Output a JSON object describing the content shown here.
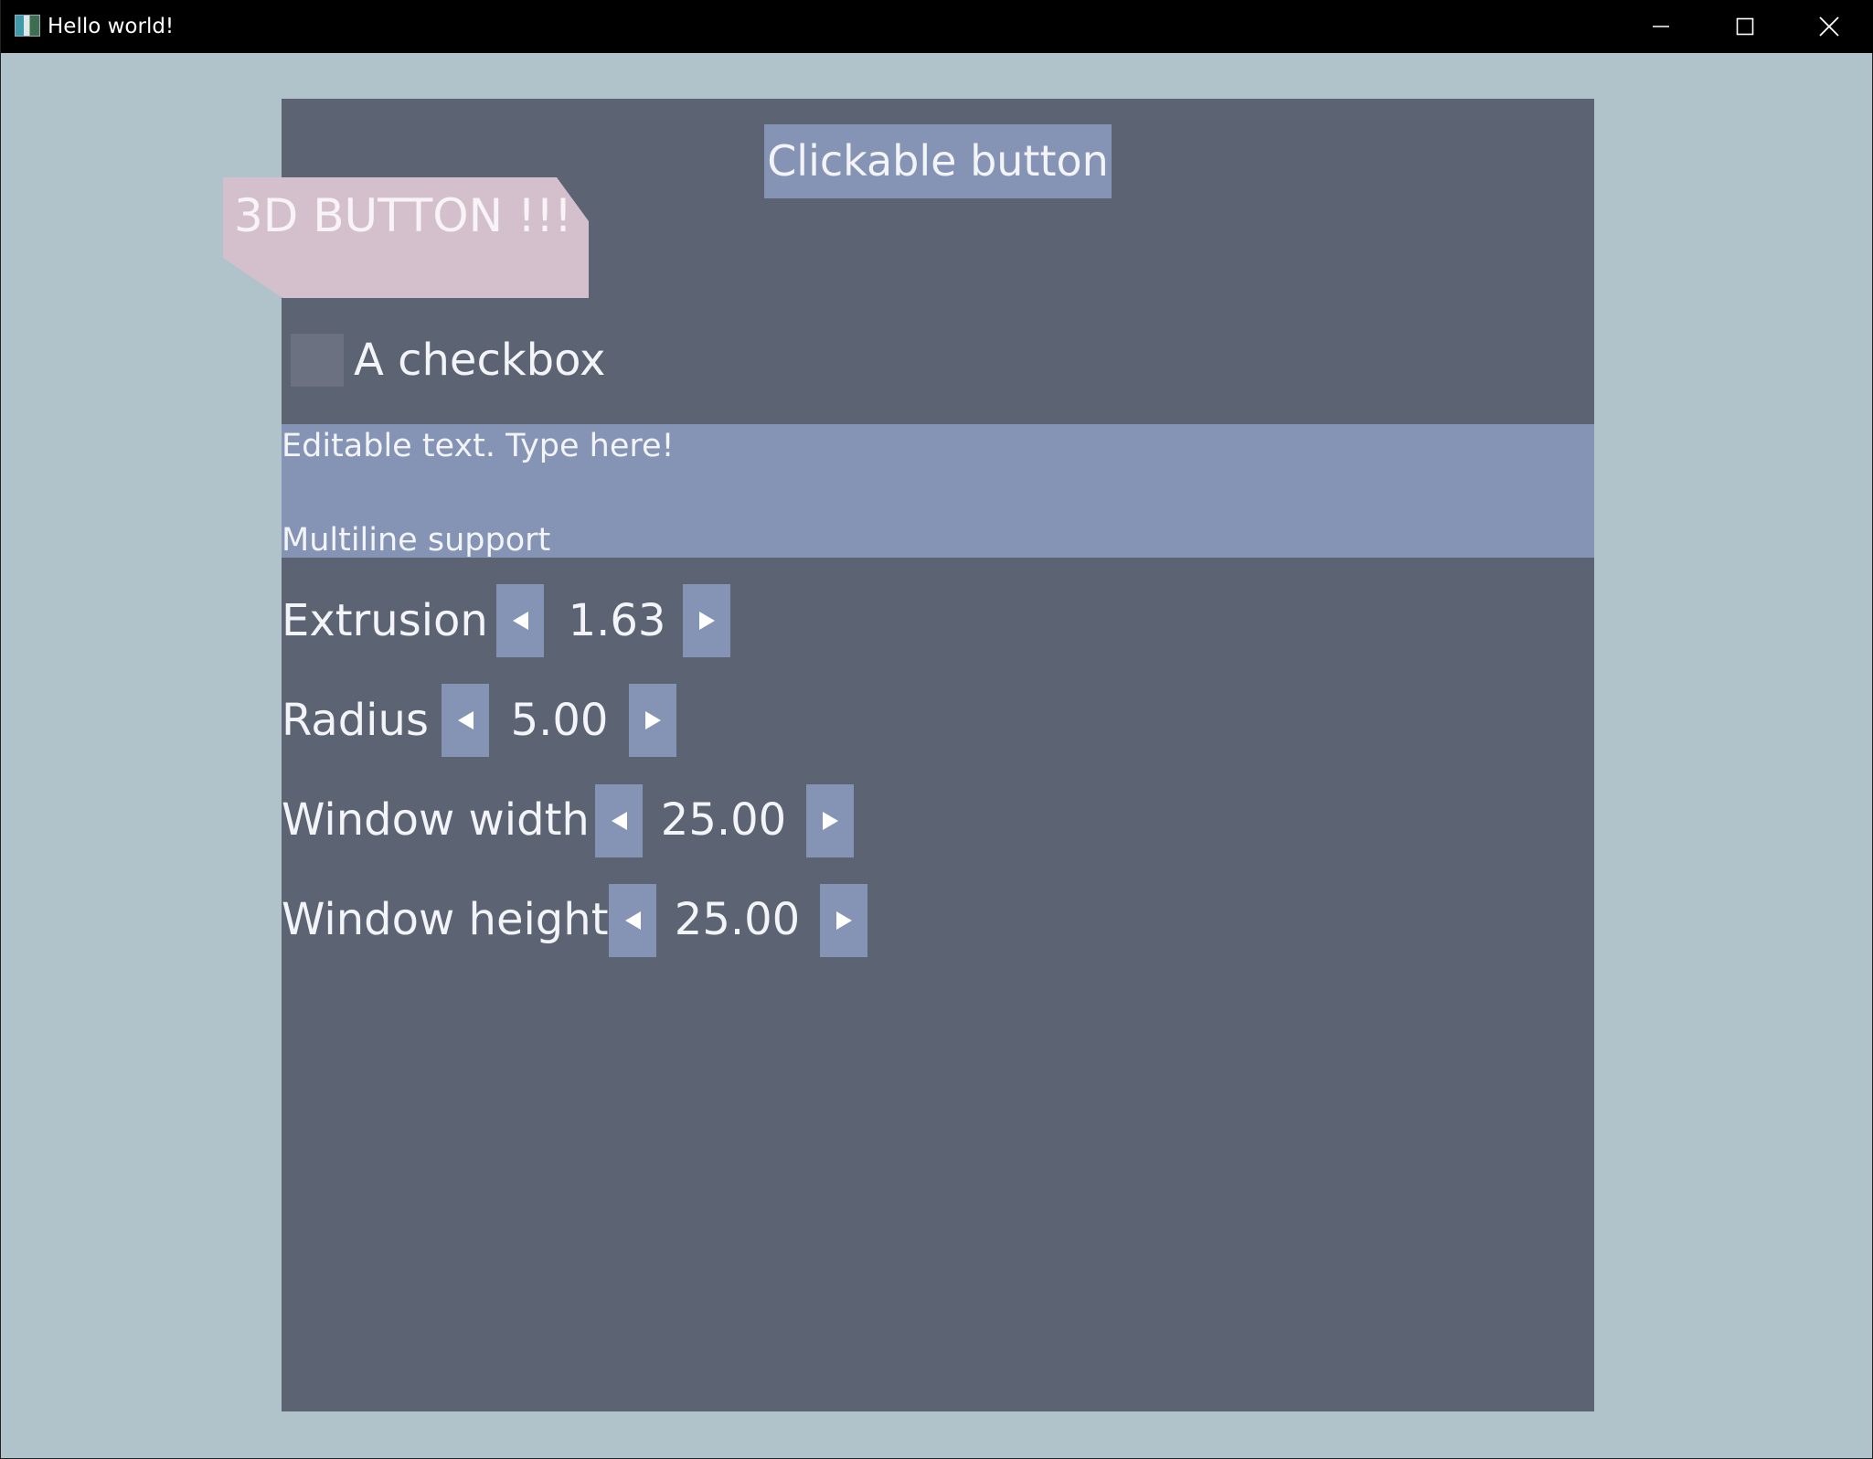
{
  "window": {
    "title": "Hello world!",
    "controls": {
      "minimize_icon": "minimize-icon",
      "maximize_icon": "maximize-icon",
      "close_icon": "close-icon"
    }
  },
  "colors": {
    "background": "#b1c3ca",
    "panel": "#5c6373",
    "accent": "#8593b4",
    "button3d": "#d4bfcc",
    "text": "#f2f4f8"
  },
  "clickable_button": {
    "label": "Clickable button"
  },
  "button_3d": {
    "label": "3D BUTTON !!!"
  },
  "checkbox": {
    "label": "A checkbox",
    "checked": false
  },
  "editable_text": {
    "line1": "Editable text. Type here!",
    "line2": "",
    "line3": "Multiline support"
  },
  "spinners": [
    {
      "label": "Extrusion",
      "value": "1.63"
    },
    {
      "label": "Radius",
      "value": "5.00"
    },
    {
      "label": "Window width",
      "value": "25.00"
    },
    {
      "label": "Window height",
      "value": "25.00"
    }
  ]
}
